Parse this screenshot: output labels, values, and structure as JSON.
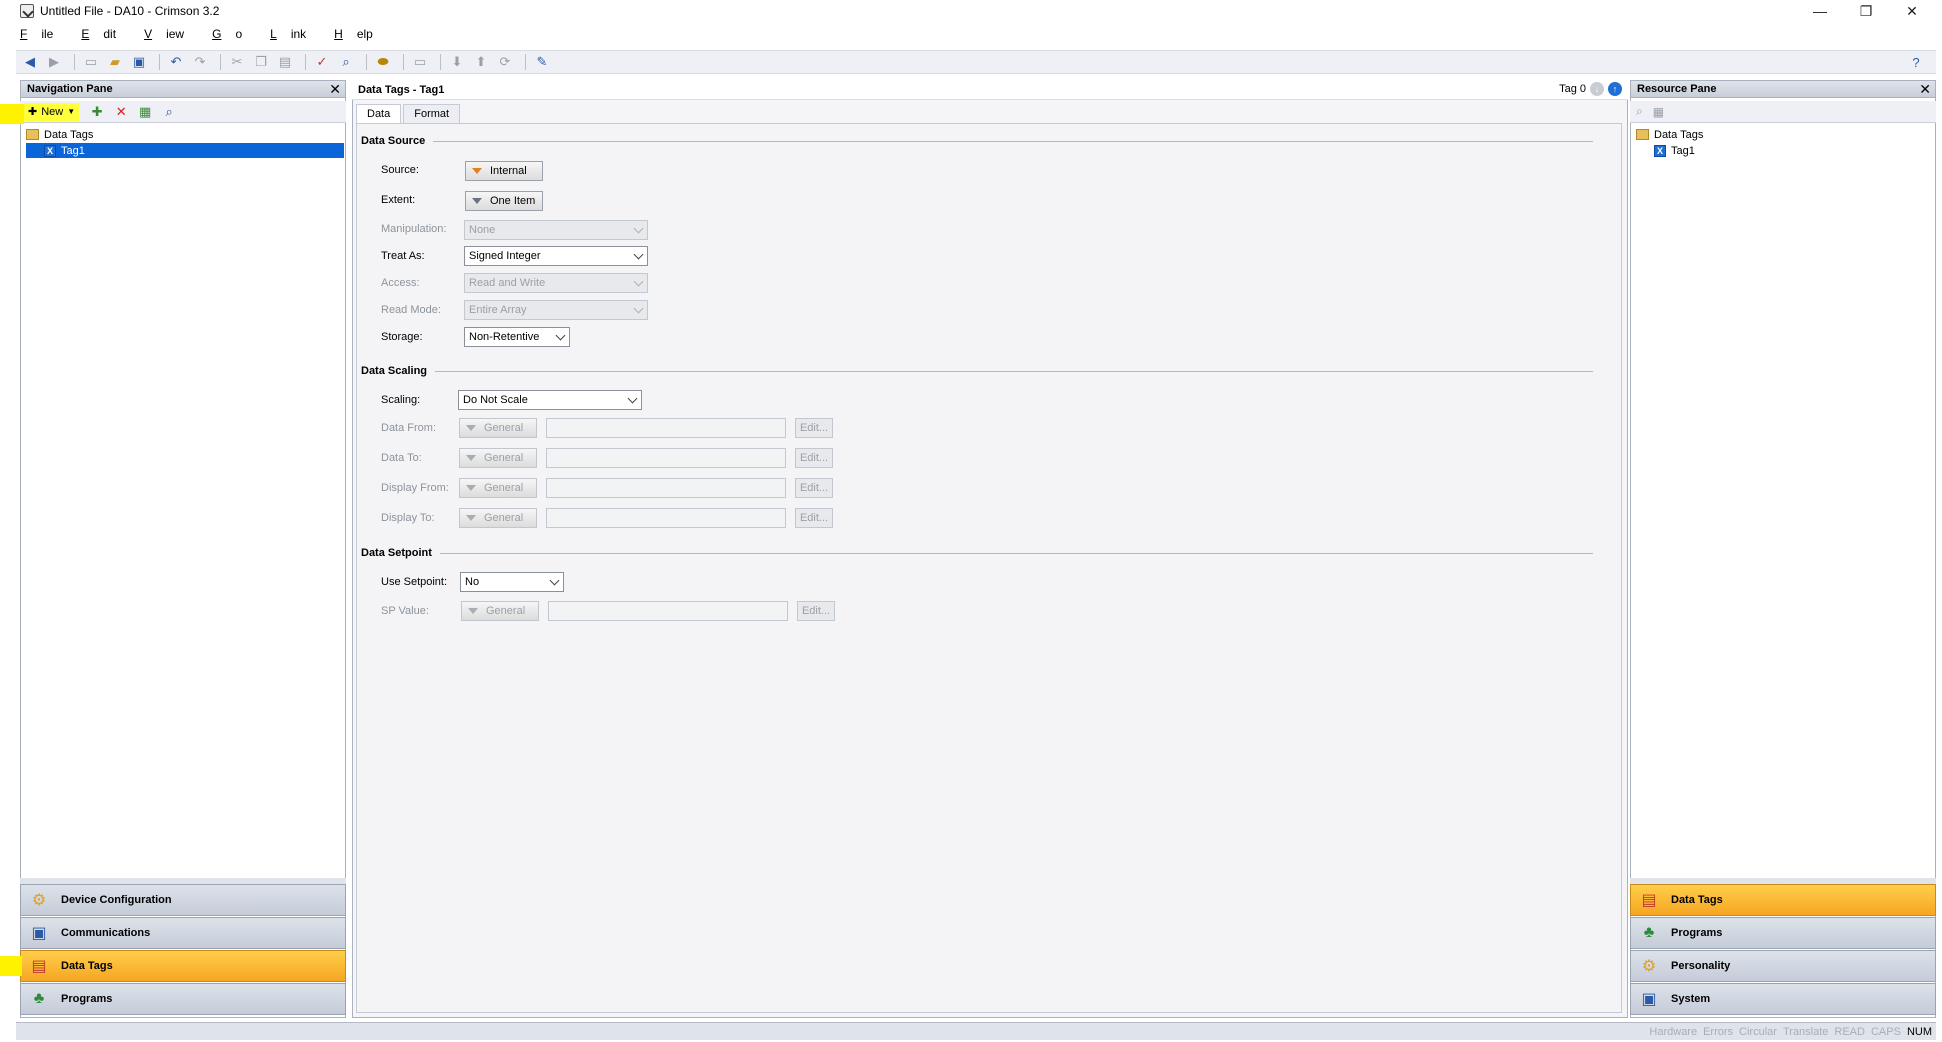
{
  "window": {
    "title": "Untitled File - DA10 - Crimson 3.2",
    "controls": {
      "minimize": "—",
      "restore": "❐",
      "close": "✕"
    }
  },
  "menu": [
    {
      "label": "File",
      "accel": "F",
      "rest": "ile"
    },
    {
      "label": "Edit",
      "accel": "E",
      "rest": "dit"
    },
    {
      "label": "View",
      "accel": "V",
      "rest": "iew"
    },
    {
      "label": "Go",
      "accel": "G",
      "rest": "o"
    },
    {
      "label": "Link",
      "accel": "L",
      "rest": "ink"
    },
    {
      "label": "Help",
      "accel": "H",
      "rest": "elp"
    }
  ],
  "navigation_pane": {
    "title": "Navigation Pane",
    "new_label": "New",
    "tree": {
      "root": "Data Tags",
      "items": [
        "Tag1"
      ],
      "selected": "Tag1"
    },
    "categories": [
      {
        "label": "Device Configuration",
        "icon": "gear-icon",
        "active": false
      },
      {
        "label": "Communications",
        "icon": "network-icon",
        "active": false
      },
      {
        "label": "Data Tags",
        "icon": "tags-icon",
        "active": true
      },
      {
        "label": "Programs",
        "icon": "programs-icon",
        "active": false
      }
    ]
  },
  "editor": {
    "header": "Data Tags - Tag1",
    "tag_index": "Tag 0",
    "tabs": [
      "Data",
      "Format"
    ],
    "active_tab": "Data",
    "data_source": {
      "title": "Data Source",
      "source_label": "Source:",
      "source_value": "Internal",
      "extent_label": "Extent:",
      "extent_value": "One Item",
      "manipulation_label": "Manipulation:",
      "manipulation_value": "None",
      "treat_as_label": "Treat As:",
      "treat_as_value": "Signed Integer",
      "access_label": "Access:",
      "access_value": "Read and Write",
      "read_mode_label": "Read Mode:",
      "read_mode_value": "Entire Array",
      "storage_label": "Storage:",
      "storage_value": "Non-Retentive"
    },
    "data_scaling": {
      "title": "Data Scaling",
      "scaling_label": "Scaling:",
      "scaling_value": "Do Not Scale",
      "rows": [
        {
          "label": "Data From:",
          "type": "General",
          "edit": "Edit..."
        },
        {
          "label": "Data To:",
          "type": "General",
          "edit": "Edit..."
        },
        {
          "label": "Display From:",
          "type": "General",
          "edit": "Edit..."
        },
        {
          "label": "Display To:",
          "type": "General",
          "edit": "Edit..."
        }
      ]
    },
    "data_setpoint": {
      "title": "Data Setpoint",
      "use_setpoint_label": "Use Setpoint:",
      "use_setpoint_value": "No",
      "sp_value_label": "SP Value:",
      "sp_value_type": "General",
      "sp_value_edit": "Edit..."
    }
  },
  "resource_pane": {
    "title": "Resource Pane",
    "tree": {
      "root": "Data Tags",
      "items": [
        "Tag1"
      ]
    },
    "categories": [
      {
        "label": "Data Tags",
        "icon": "tags-icon",
        "active": true
      },
      {
        "label": "Programs",
        "icon": "programs-icon",
        "active": false
      },
      {
        "label": "Personality",
        "icon": "gear-icon",
        "active": false
      },
      {
        "label": "System",
        "icon": "system-icon",
        "active": false
      }
    ]
  },
  "statusbar": {
    "items": [
      {
        "label": "Hardware",
        "on": false
      },
      {
        "label": "Errors",
        "on": false
      },
      {
        "label": "Circular",
        "on": false
      },
      {
        "label": "Translate",
        "on": false
      },
      {
        "label": "READ",
        "on": false
      },
      {
        "label": "CAPS",
        "on": false
      },
      {
        "label": "NUM",
        "on": true
      }
    ]
  },
  "colors": {
    "accent_active": "#f6a623",
    "selection": "#0a66d8",
    "highlight": "#fff200"
  }
}
